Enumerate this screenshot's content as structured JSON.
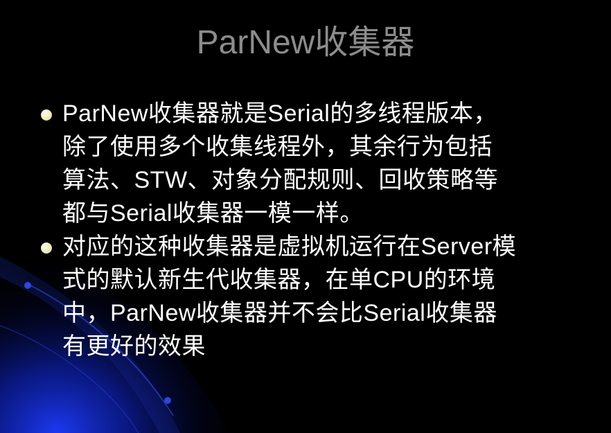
{
  "slide": {
    "title": "ParNew收集器",
    "bullets": [
      {
        "lines": [
          "ParNew收集器就是Serial的多线程版本，",
          "除了使用多个收集线程外，其余行为包括",
          "算法、STW、对象分配规则、回收策略等",
          "都与Serial收集器一模一样。"
        ]
      },
      {
        "lines": [
          "对应的这种收集器是虚拟机运行在Server模",
          "式的默认新生代收集器，在单CPU的环境",
          "中，ParNew收集器并不会比Serial收集器",
          "有更好的效果"
        ]
      }
    ]
  },
  "colors": {
    "background": "#000000",
    "title": "#8c8c8c",
    "body_text": "#ffffff",
    "bullet": "#f2efc4",
    "accent_blue": "#1a2fd0"
  }
}
